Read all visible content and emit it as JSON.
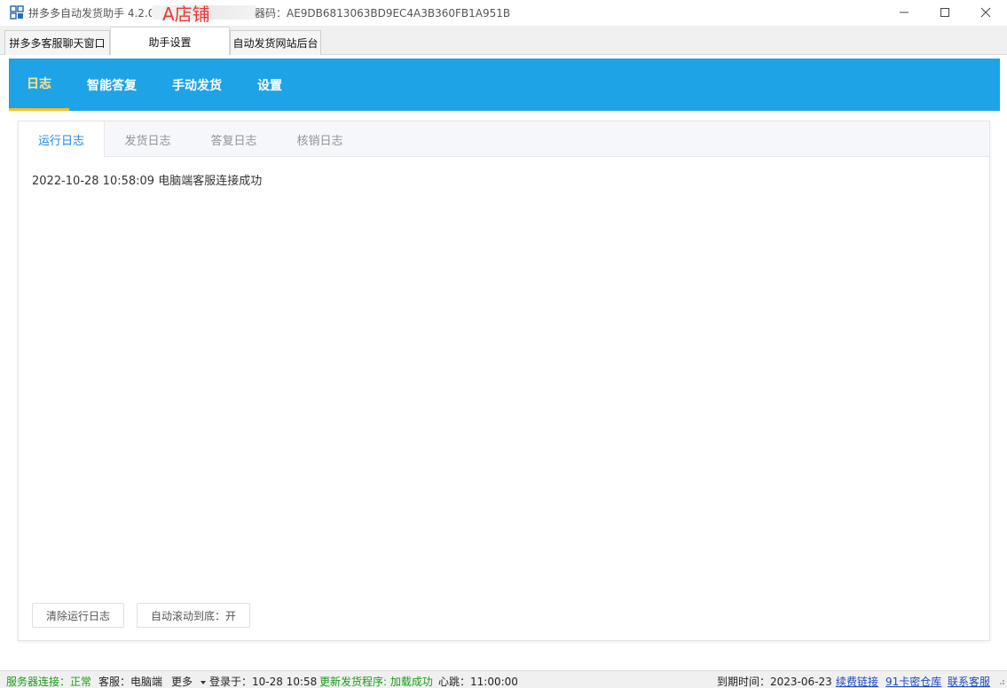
{
  "window": {
    "title": "拼多多自动发货助手 4.2.0（",
    "code_text": "器码：AE9DB6813063BD9EC4A3B360FB1A951B",
    "shop_overlay": "A店铺",
    "icons": {
      "app": "app-grid-icon",
      "minimize": "minimize-icon",
      "maximize": "maximize-icon",
      "close": "close-icon"
    }
  },
  "outer_tabs": [
    {
      "label": "拼多多客服聊天窗口"
    },
    {
      "label": "助手设置"
    },
    {
      "label": "自动发货网站后台"
    }
  ],
  "nav": [
    {
      "label": "日志"
    },
    {
      "label": "智能答复"
    },
    {
      "label": "手动发货"
    },
    {
      "label": "设置"
    }
  ],
  "log_tabs": [
    {
      "label": "运行日志"
    },
    {
      "label": "发货日志"
    },
    {
      "label": "答复日志"
    },
    {
      "label": "核销日志"
    }
  ],
  "log_entries": [
    "2022-10-28 10:58:09 电脑端客服连接成功"
  ],
  "buttons": {
    "clear": "清除运行日志",
    "autoscroll": "自动滚动到底：开"
  },
  "status": {
    "server_label": "服务器连接：",
    "server_value": "正常",
    "service_label": "客服：电脑端",
    "more": "更多",
    "login": "登录于：10-28 10:58",
    "update": "更新发货程序: 加载成功",
    "heartbeat": "心跳：11:00:00",
    "expire": "到期时间：2023-06-23",
    "renew": "续费链接",
    "kami": "91卡密仓库",
    "contact": "联系客服"
  },
  "colors": {
    "nav_bg": "#1ea3e6",
    "nav_active": "#fde68a",
    "tab_active": "#1e88e5",
    "status_ok": "#1a9b1a",
    "link": "#1a49c4",
    "overlay_red": "#e53935"
  }
}
